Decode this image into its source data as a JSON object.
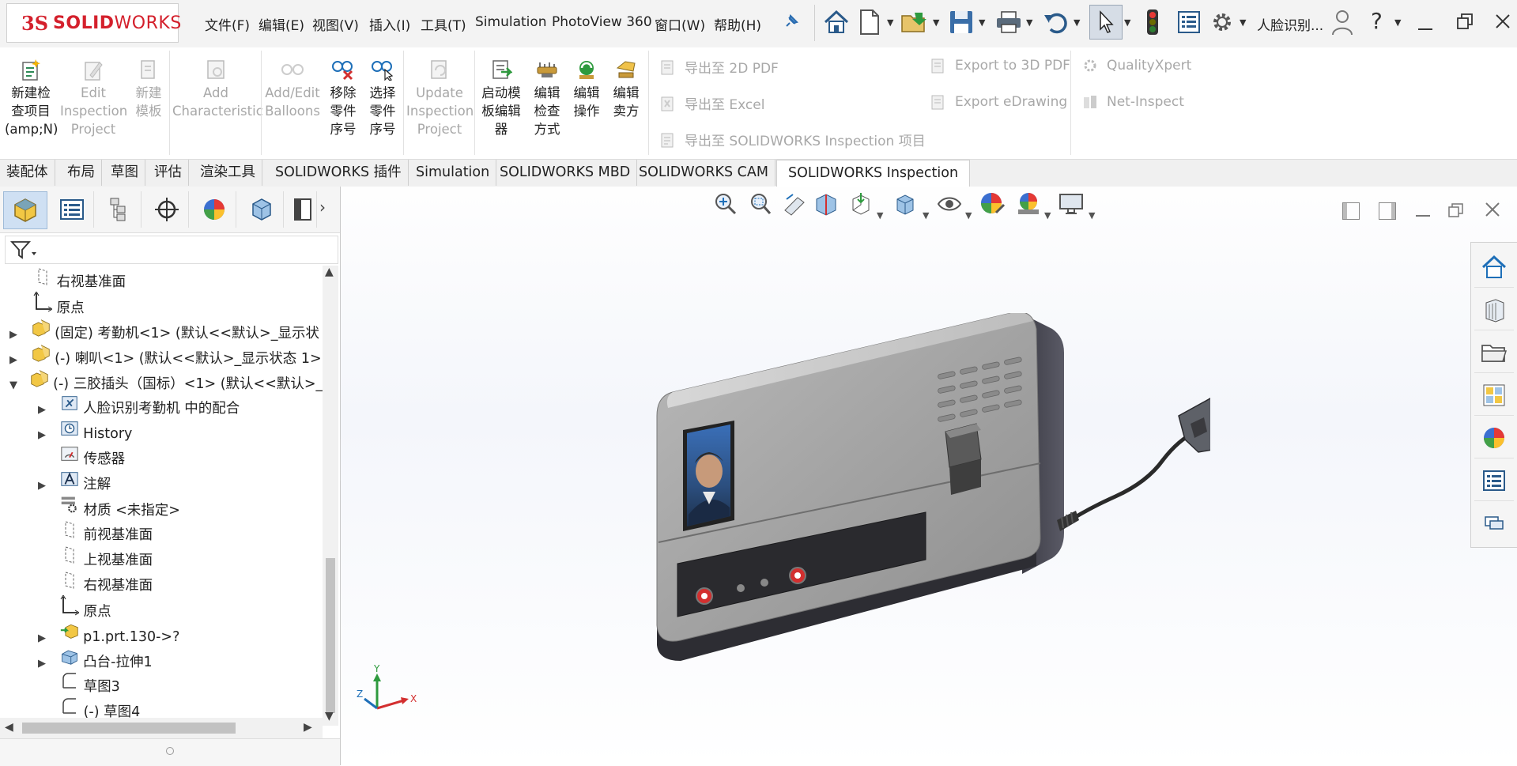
{
  "app": {
    "logo_ds": "3S",
    "logo_text_bold": "SOLID",
    "logo_text_rest": "WORKS"
  },
  "menu": [
    "文件(F)",
    "编辑(E)",
    "视图(V)",
    "插入(I)",
    "工具(T)",
    "Simulation",
    "PhotoView 360",
    "窗口(W)",
    "帮助(H)"
  ],
  "user_label": "人脸识别...",
  "help_label": "?",
  "ribbon": {
    "new_item": [
      "新建检",
      "查项目",
      "(amp;N)"
    ],
    "edit_project": [
      "Edit",
      "Inspection",
      "Project"
    ],
    "new_template": [
      "新建",
      "模板"
    ],
    "add_characteristic": [
      "Add",
      "Characteristic"
    ],
    "add_edit_balloons": [
      "Add/Edit",
      "Balloons"
    ],
    "remove_balloon": [
      "移除",
      "零件",
      "序号"
    ],
    "select_balloon": [
      "选择",
      "零件",
      "序号"
    ],
    "update_project": [
      "Update",
      "Inspection",
      "Project"
    ],
    "launch_template_editor": [
      "启动模",
      "板编辑",
      "器"
    ],
    "edit_check_method": [
      "编辑",
      "检查",
      "方式"
    ],
    "edit_operation": [
      "编辑",
      "操作"
    ],
    "edit_vendor": [
      "编辑",
      "卖方"
    ],
    "export_2d_pdf": "导出至 2D PDF",
    "export_excel": "导出至 Excel",
    "export_sw_inspection": "导出至 SOLIDWORKS Inspection 项目",
    "export_3d_pdf": "Export to 3D PDF",
    "export_edrawing": "Export eDrawing",
    "quality_xpert": "QualityXpert",
    "net_inspect": "Net-Inspect"
  },
  "tabs": [
    "装配体",
    "布局",
    "草图",
    "评估",
    "渲染工具",
    "SOLIDWORKS 插件",
    "Simulation",
    "SOLIDWORKS MBD",
    "SOLIDWORKS CAM",
    "SOLIDWORKS Inspection"
  ],
  "tree": [
    {
      "label": "右视基准面"
    },
    {
      "label": "原点"
    },
    {
      "label": "(固定) 考勤机<1> (默认<<默认>_显示状"
    },
    {
      "label": "(-) 喇叭<1> (默认<<默认>_显示状态 1>"
    },
    {
      "label": "(-) 三胶插头（国标）<1> (默认<<默认>_"
    },
    {
      "label": "人脸识别考勤机 中的配合"
    },
    {
      "label": "History"
    },
    {
      "label": "传感器"
    },
    {
      "label": "注解"
    },
    {
      "label": "材质 <未指定>"
    },
    {
      "label": "前视基准面"
    },
    {
      "label": "上视基准面"
    },
    {
      "label": "右视基准面"
    },
    {
      "label": "原点"
    },
    {
      "label": "p1.prt.130->?"
    },
    {
      "label": "凸台-拉伸1"
    },
    {
      "label": "草图3"
    },
    {
      "label": "(-) 草图4"
    }
  ],
  "triad": {
    "x": "X",
    "y": "Y",
    "z": "Z"
  },
  "colors": {
    "brand_red": "#d4202c",
    "accent_blue": "#1e6fb8"
  }
}
